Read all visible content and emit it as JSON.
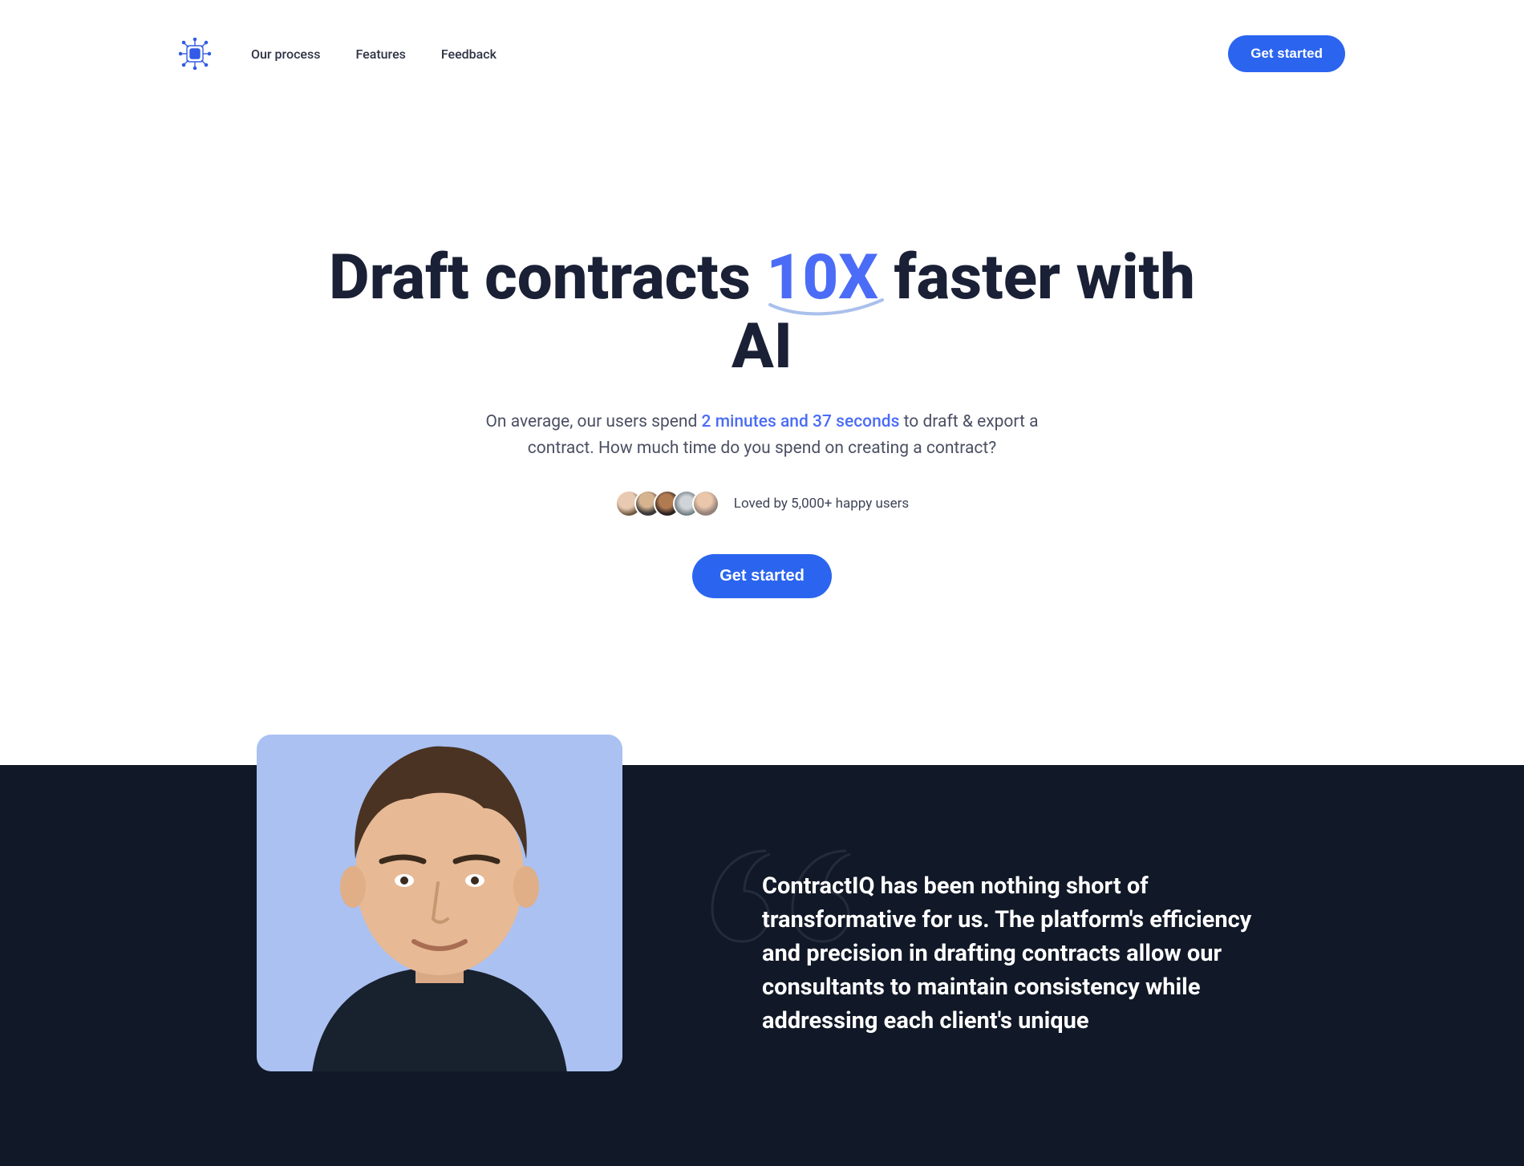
{
  "nav": {
    "links": [
      "Our process",
      "Features",
      "Feedback"
    ],
    "cta": "Get started"
  },
  "hero": {
    "title_pre": "Draft contracts ",
    "title_highlight": "10X",
    "title_post": " faster with AI",
    "sub_pre": "On average, our users spend ",
    "sub_highlight": "2 minutes and 37 seconds",
    "sub_post": " to draft & export a contract. How much time do you spend on creating a contract?",
    "social_proof": "Loved by 5,000+ happy users",
    "cta": "Get started"
  },
  "testimonial": {
    "quote": "ContractIQ has been nothing short of transformative for us. The platform's efficiency and precision in drafting contracts allow our consultants to maintain consistency while addressing each client's unique"
  },
  "colors": {
    "brand": "#2b65ef",
    "dark_bg": "#111827",
    "heading": "#1a2035"
  }
}
